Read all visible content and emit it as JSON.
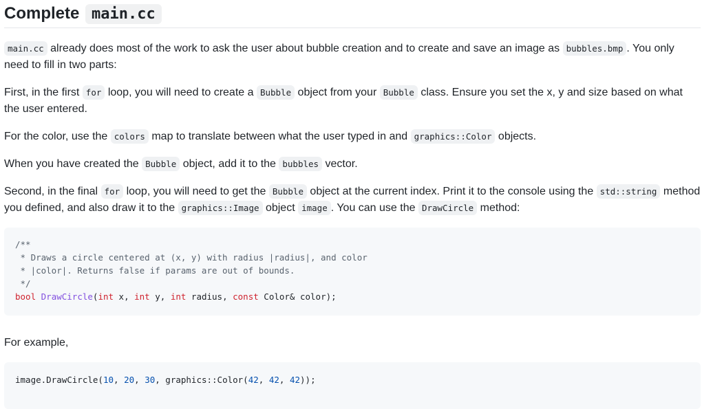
{
  "heading": {
    "text": "Complete",
    "code": "main.cc"
  },
  "paragraphs": {
    "p1": {
      "code1": "main.cc",
      "t1": " already does most of the work to ask the user about bubble creation and to create and save an image as ",
      "code2": "bubbles.bmp",
      "t2": ". You only need to fill in two parts:"
    },
    "p2": {
      "t1": "First, in the first ",
      "code1": "for",
      "t2": " loop, you will need to create a ",
      "code2": "Bubble",
      "t3": " object from your ",
      "code3": "Bubble",
      "t4": " class. Ensure you set the x, y and size based on what the user entered."
    },
    "p3": {
      "t1": "For the color, use the ",
      "code1": "colors",
      "t2": " map to translate between what the user typed in and ",
      "code2": "graphics::Color",
      "t3": " objects."
    },
    "p4": {
      "t1": "When you have created the ",
      "code1": "Bubble",
      "t2": " object, add it to the ",
      "code2": "bubbles",
      "t3": " vector."
    },
    "p5": {
      "t1": "Second, in the final ",
      "code1": "for",
      "t2": " loop, you will need to get the ",
      "code2": "Bubble",
      "t3": " object at the current index. Print it to the console using the ",
      "code3": "std::string",
      "t4": " method you defined, and also draw it to the ",
      "code4": "graphics::Image",
      "t5": " object ",
      "code5": "image",
      "t6": ". You can use the ",
      "code6": "DrawCircle",
      "t7": " method:"
    },
    "p6": {
      "text": "For example,"
    }
  },
  "code_block_1": {
    "comment_lines": [
      "/**",
      " * Draws a circle centered at (x, y) with radius |radius|, and color",
      " * |color|. Returns false if params are out of bounds.",
      " */"
    ],
    "signature": {
      "ret": "bool",
      "fn": "DrawCircle",
      "open": "(",
      "k1": "int",
      "a1": " x, ",
      "k2": "int",
      "a2": " y, ",
      "k3": "int",
      "a3": " radius, ",
      "k4": "const",
      "a4": " Color& color);"
    }
  },
  "code_block_2": {
    "prefix": "image.DrawCircle(",
    "n1": "10",
    "s1": ", ",
    "n2": "20",
    "s2": ", ",
    "n3": "30",
    "s3": ", graphics::Color(",
    "n4": "42",
    "s4": ", ",
    "n5": "42",
    "s5": ", ",
    "n6": "42",
    "suffix": "));"
  },
  "colors": {
    "text": "#1f2328",
    "inline_code_bg": "#eff1f3",
    "code_block_bg": "#f6f8fa",
    "comment": "#59636e",
    "keyword": "#cf222e",
    "function": "#8250df",
    "number": "#0550ae"
  }
}
